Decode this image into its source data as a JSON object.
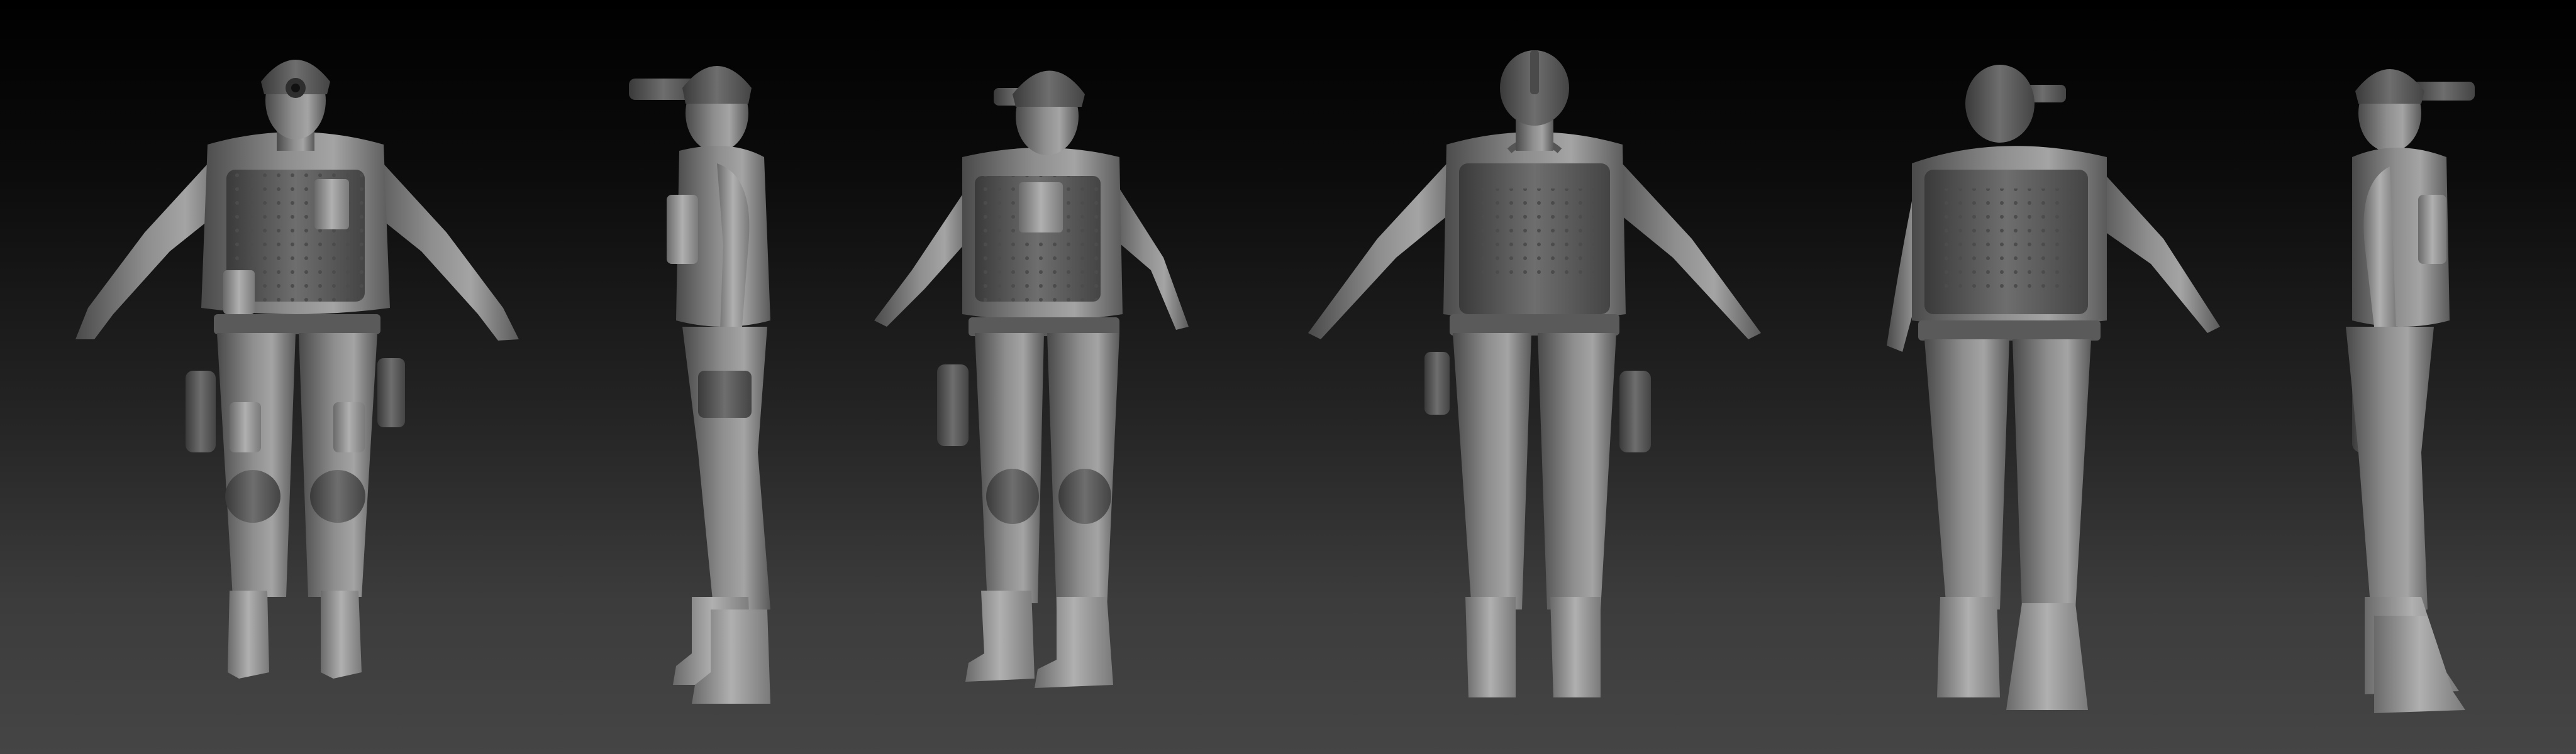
{
  "scene": {
    "background_top": "#000000",
    "background_bottom": "#454545",
    "material_color": "#8a8a8a",
    "shadow_color": "#3a3a3a",
    "highlight_color": "#b4b4b4"
  },
  "views": [
    {
      "name": "front"
    },
    {
      "name": "left-side"
    },
    {
      "name": "front-three-quarter"
    },
    {
      "name": "back"
    },
    {
      "name": "back-three-quarter"
    },
    {
      "name": "right-side"
    }
  ]
}
